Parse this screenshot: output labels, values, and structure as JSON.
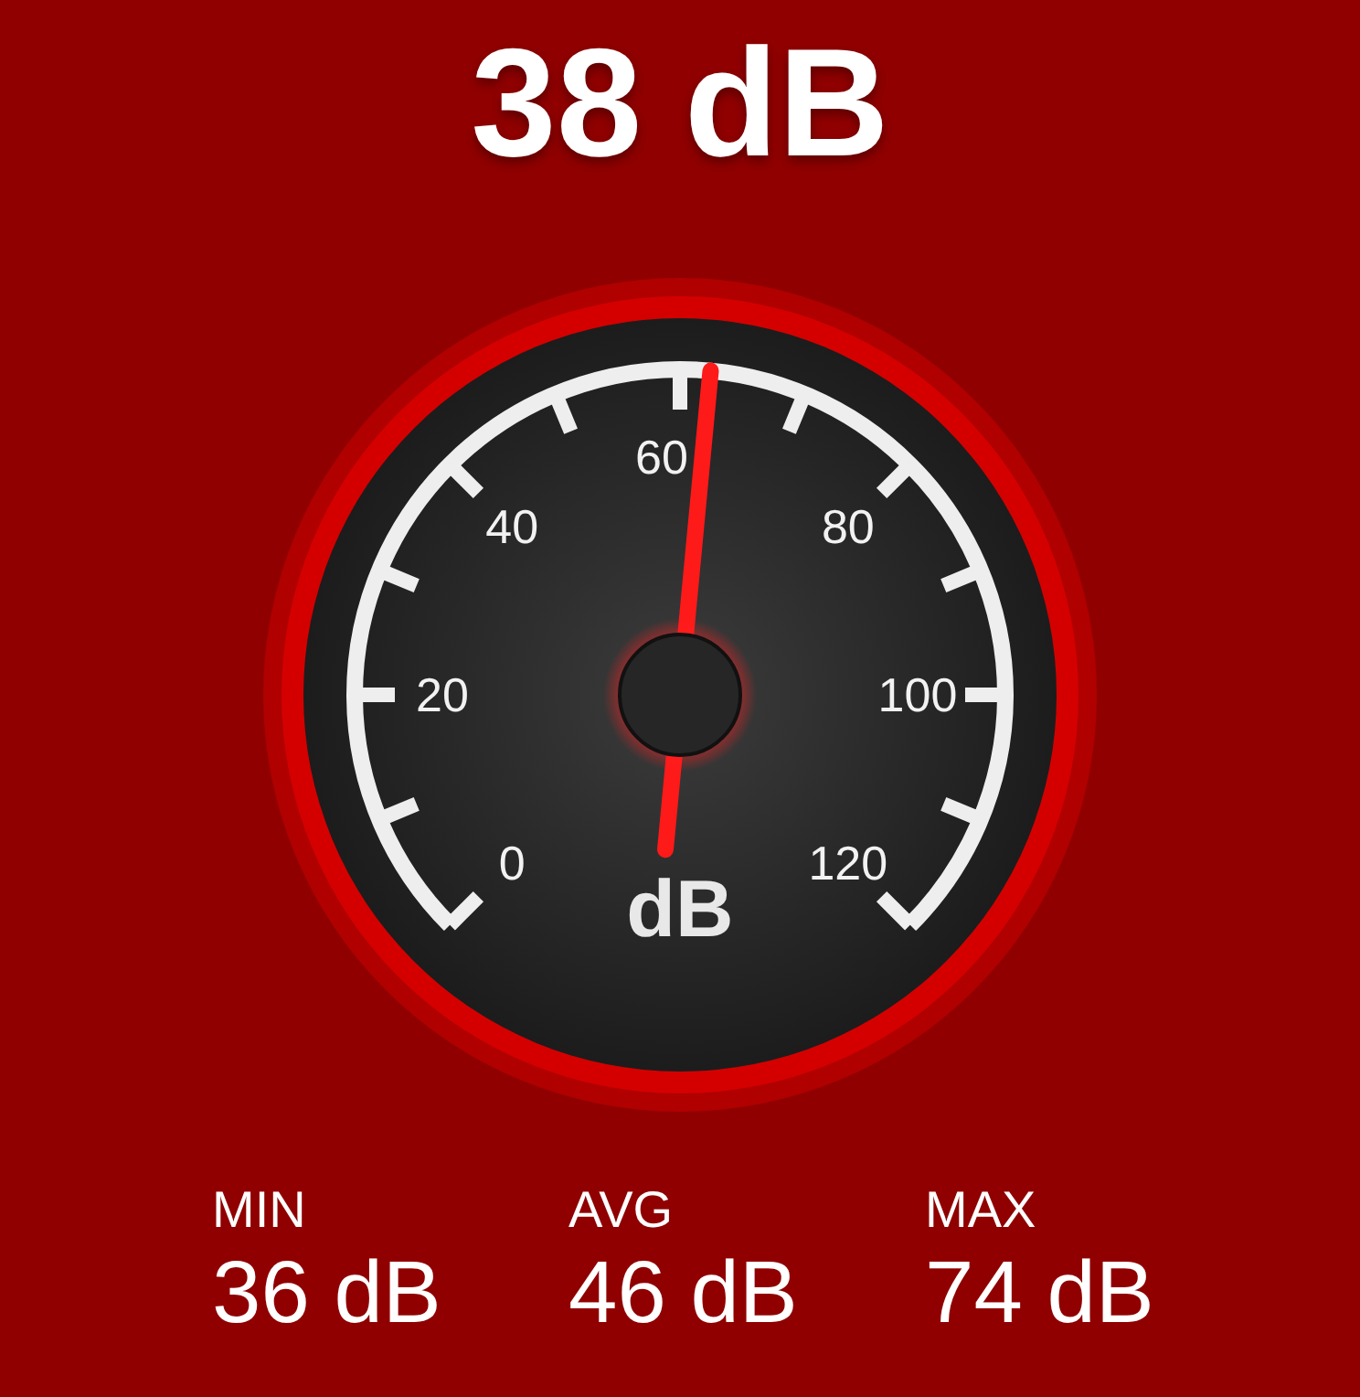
{
  "reading": "38 dB",
  "gauge": {
    "level": 0.52,
    "unit": "dB",
    "scale_labels": [
      "0",
      "20",
      "40",
      "60",
      "80",
      "100",
      "120"
    ]
  },
  "stats": [
    {
      "label": "MIN",
      "value": "36 dB"
    },
    {
      "label": "AVG",
      "value": "46 dB"
    },
    {
      "label": "MAX",
      "value": "74 dB"
    }
  ]
}
